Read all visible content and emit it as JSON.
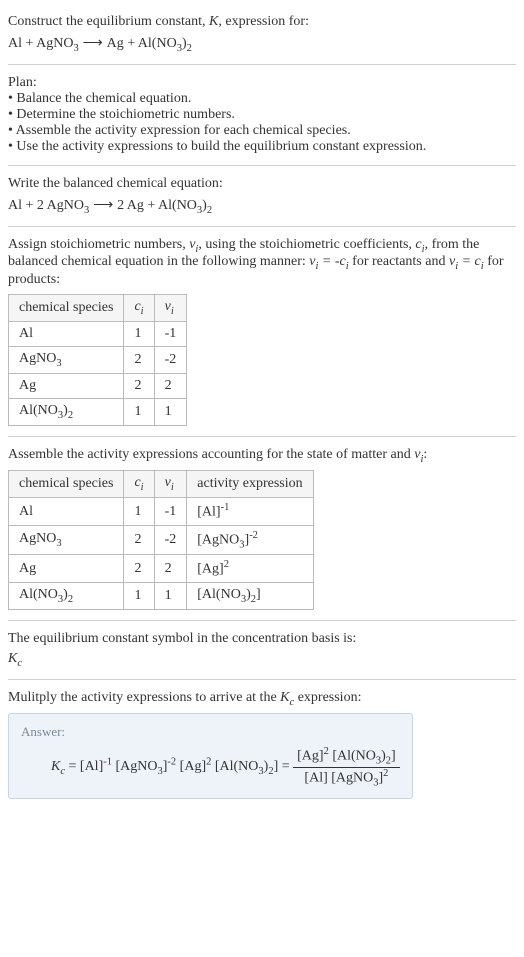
{
  "intro": {
    "line1": "Construct the equilibrium constant, ",
    "k": "K",
    "line1b": ", expression for:",
    "eq_lhs": "Al + AgNO",
    "eq_sub1": "3",
    "arrow": " ⟶ ",
    "eq_rhs": "Ag + Al(NO",
    "eq_sub2": "3",
    "eq_rhs2": ")",
    "eq_sub3": "2"
  },
  "plan": {
    "title": "Plan:",
    "b1": "• Balance the chemical equation.",
    "b2": "• Determine the stoichiometric numbers.",
    "b3": "• Assemble the activity expression for each chemical species.",
    "b4": "• Use the activity expressions to build the equilibrium constant expression."
  },
  "balanced": {
    "title": "Write the balanced chemical equation:",
    "eq": "Al + 2 AgNO",
    "sub1": "3",
    "arrow": " ⟶ ",
    "rhs": "2 Ag + Al(NO",
    "sub2": "3",
    "rhs2": ")",
    "sub3": "2"
  },
  "stoich": {
    "p1": "Assign stoichiometric numbers, ",
    "nu": "ν",
    "i": "i",
    "p2": ", using the stoichiometric coefficients, ",
    "c": "c",
    "p3": ", from the balanced chemical equation in the following manner: ",
    "eq1a": "ν",
    "eq1b": " = -c",
    "p4": " for reactants and ",
    "eq2a": "ν",
    "eq2b": " = c",
    "p5": " for products:",
    "headers": {
      "h1": "chemical species",
      "h2": "c",
      "h3": "ν"
    },
    "rows": [
      {
        "species": "Al",
        "c": "1",
        "nu": "-1"
      },
      {
        "species_a": "AgNO",
        "species_sub": "3",
        "c": "2",
        "nu": "-2"
      },
      {
        "species": "Ag",
        "c": "2",
        "nu": "2"
      },
      {
        "species_a": "Al(NO",
        "species_sub": "3",
        "species_b": ")",
        "species_sub2": "2",
        "c": "1",
        "nu": "1"
      }
    ]
  },
  "activity": {
    "p1": "Assemble the activity expressions accounting for the state of matter and ",
    "nu": "ν",
    "i": "i",
    "colon": ":",
    "headers": {
      "h1": "chemical species",
      "h2": "c",
      "h3": "ν",
      "h4": "activity expression"
    }
  },
  "eqconst": {
    "p1": "The equilibrium constant symbol in the concentration basis is:",
    "k": "K",
    "c": "c"
  },
  "multiply": {
    "p1": "Mulitply the activity expressions to arrive at the ",
    "k": "K",
    "c": "c",
    "p2": " expression:"
  },
  "answer": {
    "label": "Answer:",
    "kc": "K",
    "c": "c",
    "equals": " = [Al]",
    "exp1": "-1",
    "part2": " [AgNO",
    "sub1": "3",
    "part3": "]",
    "exp2": "-2",
    "part4": " [Ag]",
    "exp3": "2",
    "part5": " [Al(NO",
    "sub2": "3",
    "part6": ")",
    "sub3": "2",
    "part7": "] = ",
    "num1": "[Ag]",
    "numexp": "2",
    "num2": " [Al(NO",
    "numsub1": "3",
    "num3": ")",
    "numsub2": "2",
    "num4": "]",
    "den1": "[Al] [AgNO",
    "densub1": "3",
    "den2": "]",
    "denexp": "2"
  },
  "table2": {
    "r1": {
      "c": "1",
      "nu": "-1",
      "ae1": "[Al]",
      "aeexp": "-1"
    },
    "r2": {
      "c": "2",
      "nu": "-2",
      "ae1": "[AgNO",
      "aesub": "3",
      "ae2": "]",
      "aeexp": "-2"
    },
    "r3": {
      "c": "2",
      "nu": "2",
      "ae1": "[Ag]",
      "aeexp": "2"
    },
    "r4": {
      "c": "1",
      "nu": "1",
      "ae1": "[Al(NO",
      "aesub": "3",
      "ae2": ")",
      "aesub2": "2",
      "ae3": "]"
    }
  }
}
